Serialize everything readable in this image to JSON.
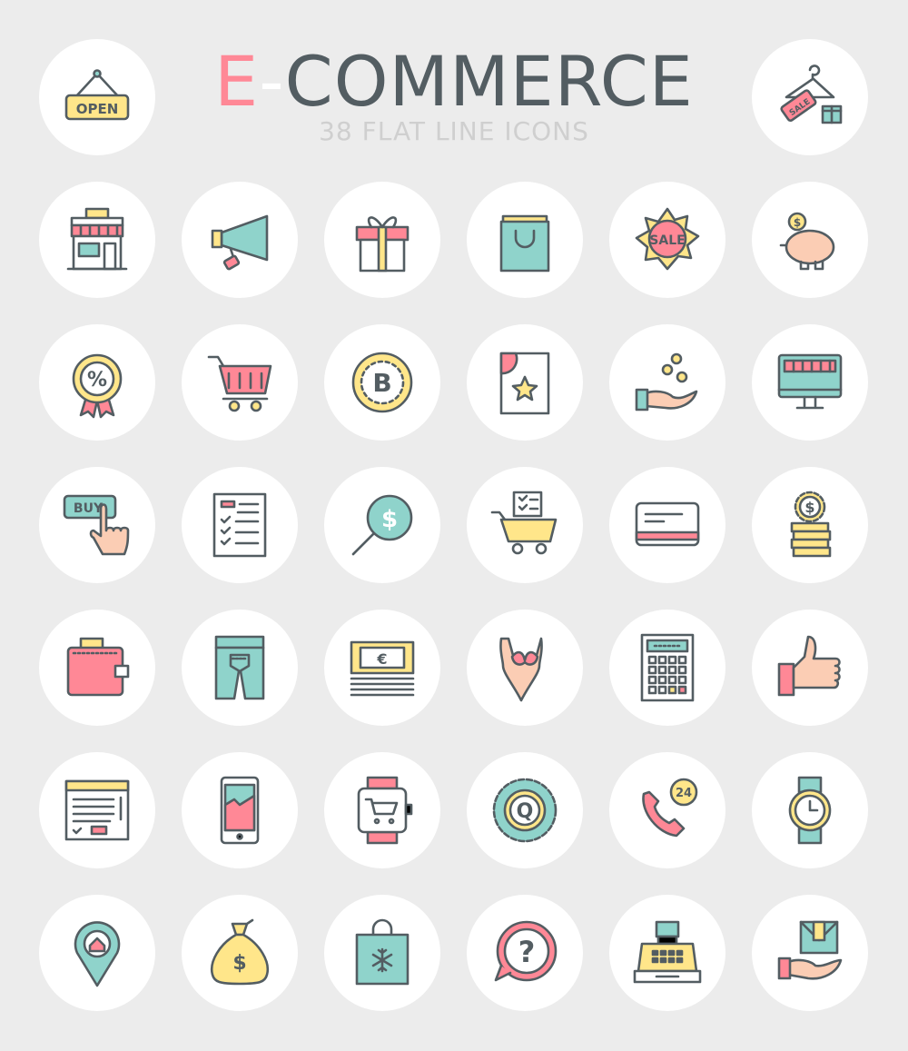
{
  "header": {
    "title_e": "E",
    "title_dash": "-",
    "title_rest": "COMMERCE",
    "subtitle": "38 FLAT LINE ICONS"
  },
  "colors": {
    "pink": "#ff8896",
    "teal": "#8fd3cb",
    "yellow": "#ffe68a",
    "outline": "#535d62",
    "background": "#ececec",
    "circle": "#ffffff",
    "skin": "#fbcdb4"
  },
  "icons": [
    {
      "name": "open-sign",
      "text": "OPEN"
    },
    {
      "name": "hanger-sale-tag",
      "text": "SALE"
    },
    {
      "name": "store"
    },
    {
      "name": "megaphone"
    },
    {
      "name": "gift-box"
    },
    {
      "name": "shopping-bag"
    },
    {
      "name": "sale-badge",
      "text": "SALE"
    },
    {
      "name": "piggy-bank",
      "text": "$"
    },
    {
      "name": "discount-badge",
      "text": "%"
    },
    {
      "name": "shopping-cart"
    },
    {
      "name": "bitcoin-coin",
      "text": "B"
    },
    {
      "name": "starred-document"
    },
    {
      "name": "hand-coins"
    },
    {
      "name": "online-store-monitor"
    },
    {
      "name": "buy-button",
      "text": "BUY"
    },
    {
      "name": "checklist"
    },
    {
      "name": "search-money",
      "text": "$"
    },
    {
      "name": "cart-checklist"
    },
    {
      "name": "credit-card"
    },
    {
      "name": "coin-stack",
      "text": "$"
    },
    {
      "name": "wallet"
    },
    {
      "name": "jeans"
    },
    {
      "name": "banknotes",
      "text": "€"
    },
    {
      "name": "swimsuit"
    },
    {
      "name": "calculator"
    },
    {
      "name": "thumbs-up"
    },
    {
      "name": "webpage"
    },
    {
      "name": "smartphone"
    },
    {
      "name": "smartwatch-cart"
    },
    {
      "name": "quality-badge",
      "text": "Q"
    },
    {
      "name": "phone-support",
      "text": "24"
    },
    {
      "name": "wristwatch"
    },
    {
      "name": "location-home"
    },
    {
      "name": "money-bag",
      "text": "$"
    },
    {
      "name": "shopping-bag-snowflake"
    },
    {
      "name": "question-bubble",
      "text": "?"
    },
    {
      "name": "cash-register"
    },
    {
      "name": "delivery-hand"
    }
  ]
}
